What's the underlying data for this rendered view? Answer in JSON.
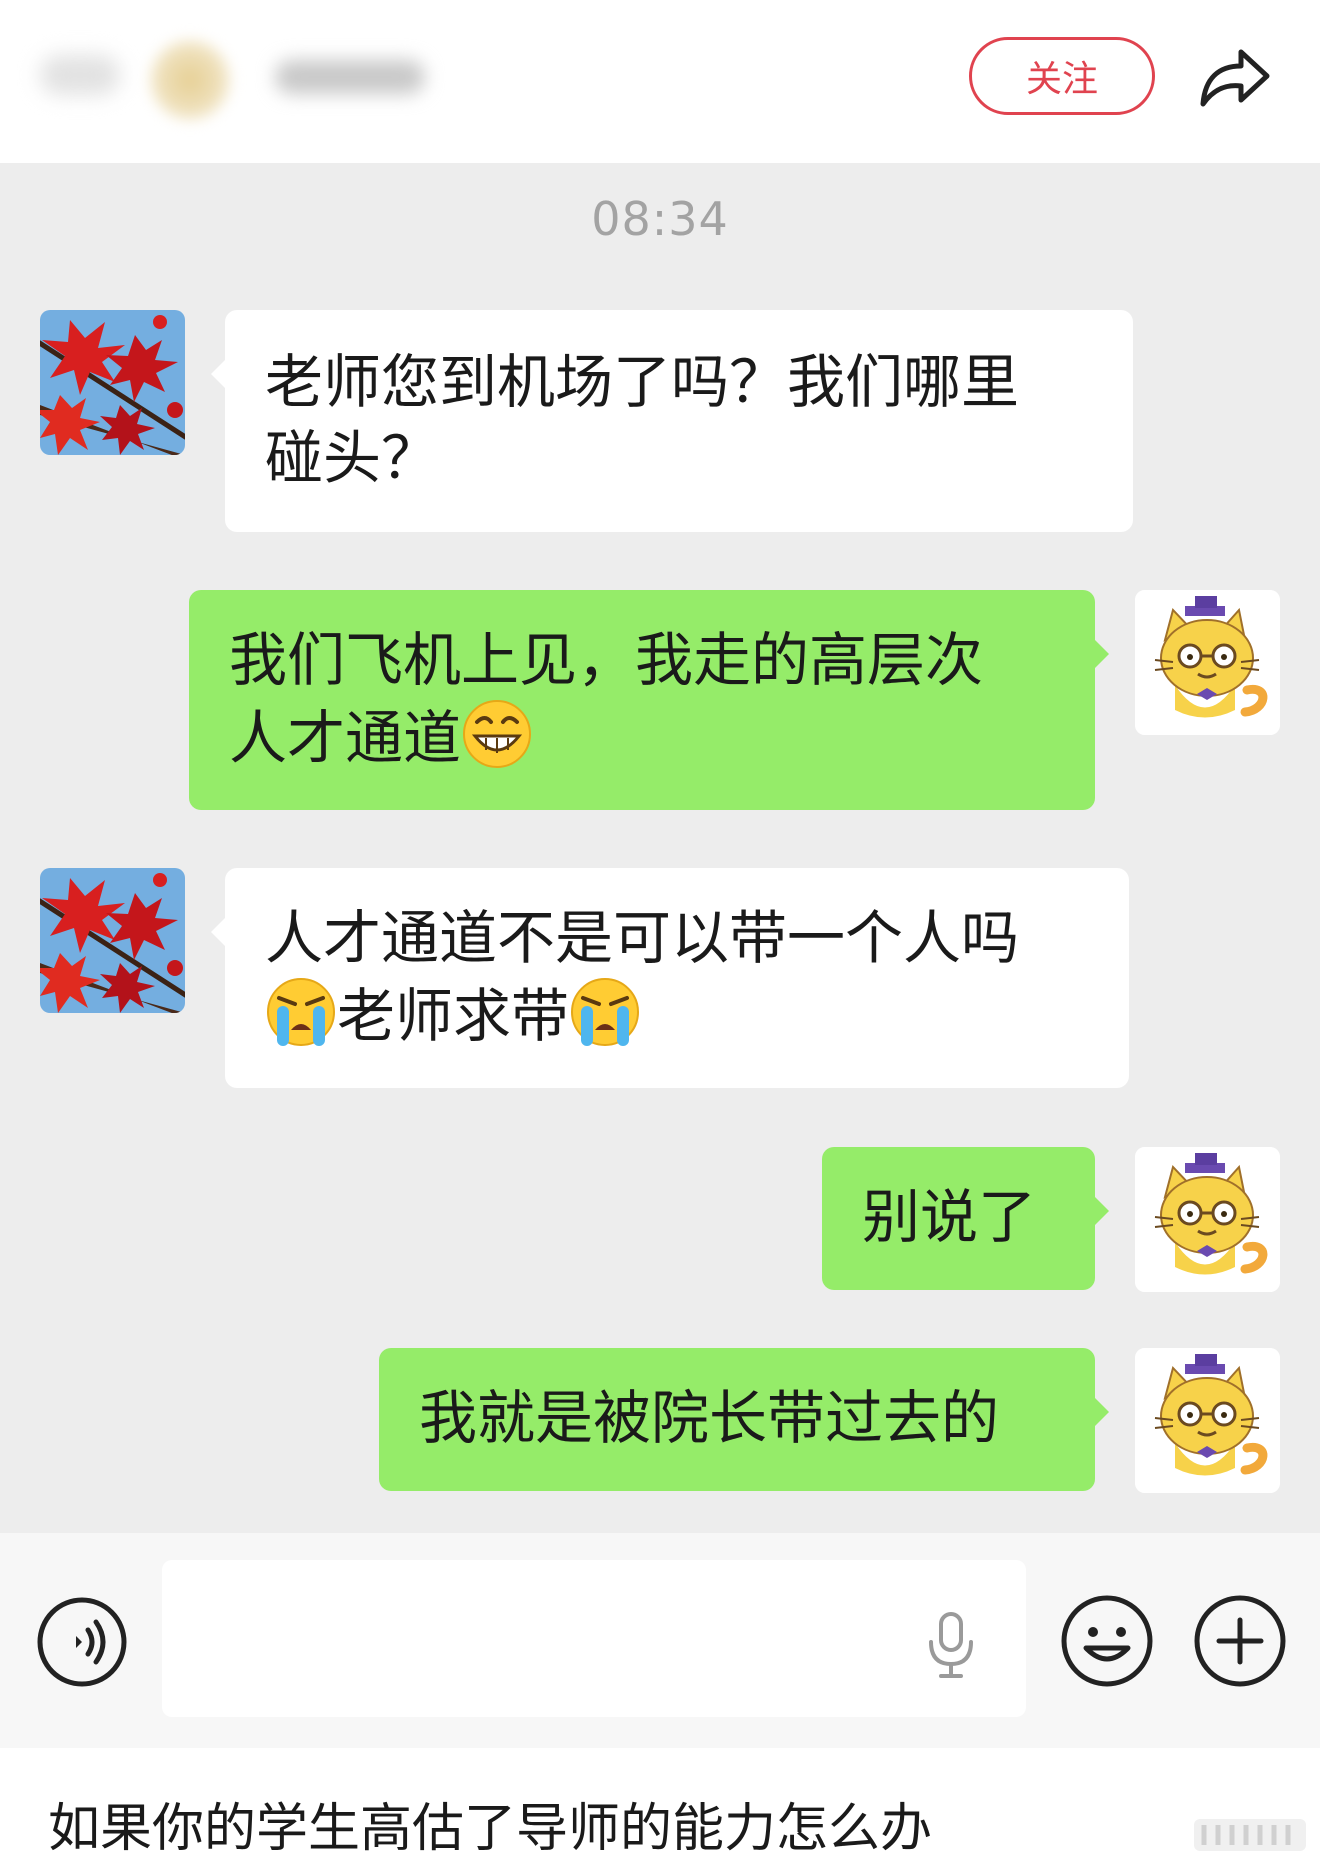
{
  "header": {
    "follow_label": "关注",
    "share_icon": "share-arrow-icon"
  },
  "chat": {
    "time": "08:34",
    "messages": [
      {
        "side": "left",
        "lines": [
          "老师您到机场了吗？我们哪里",
          "碰头？"
        ]
      },
      {
        "side": "right",
        "line1": "我们飞机上见，我走的高层次",
        "line2": "人才通道",
        "line2_emoji": "grinning-face-emoji"
      },
      {
        "side": "left",
        "line1": "人才通道不是可以带一个人吗",
        "line2_text": "老师求带",
        "line2_emoji": "loudly-crying-face-emoji"
      },
      {
        "side": "right",
        "text": "别说了"
      },
      {
        "side": "right",
        "text": "我就是被院长带过去的"
      }
    ]
  },
  "input_bar": {
    "value": "",
    "icons": [
      "voice-icon",
      "microphone-icon",
      "emoji-icon",
      "plus-icon"
    ]
  },
  "caption": "如果你的学生高估了导师的能力怎么办",
  "colors": {
    "chat_bg": "#ededed",
    "sent_bubble": "#95ec69",
    "received_bubble": "#ffffff",
    "follow_red": "#e0434f"
  }
}
